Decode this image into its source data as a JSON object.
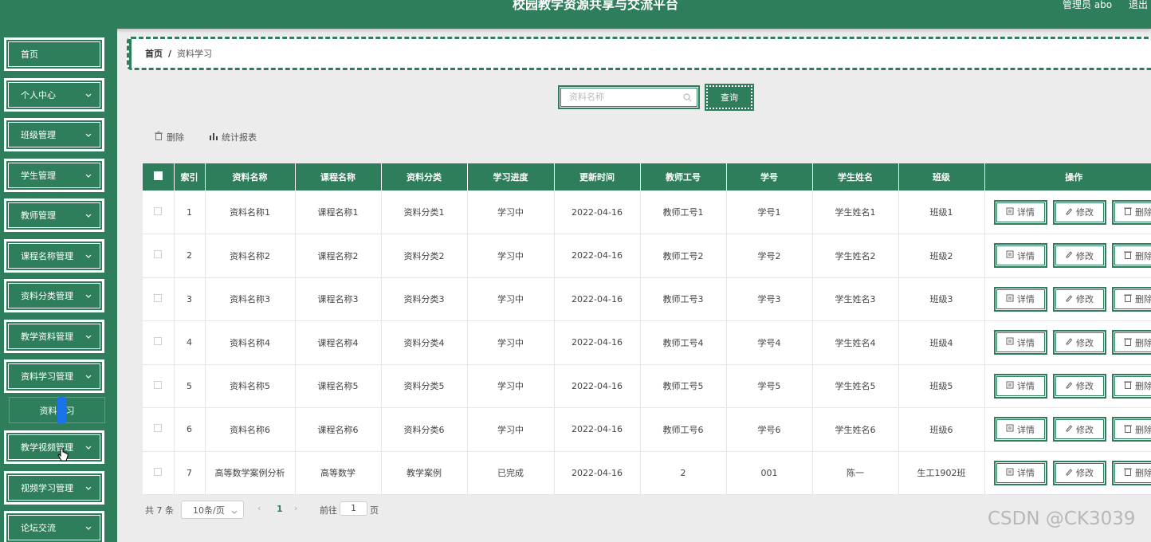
{
  "header": {
    "title": "校园教学资源共享与交流平台",
    "user": "管理员 abo",
    "logout": "退出"
  },
  "sidebar": {
    "items": [
      {
        "label": "首页",
        "expandable": false
      },
      {
        "label": "个人中心",
        "expandable": true
      },
      {
        "label": "班级管理",
        "expandable": true
      },
      {
        "label": "学生管理",
        "expandable": true
      },
      {
        "label": "教师管理",
        "expandable": true
      },
      {
        "label": "课程名称管理",
        "expandable": true
      },
      {
        "label": "资料分类管理",
        "expandable": true
      },
      {
        "label": "教学资料管理",
        "expandable": true
      },
      {
        "label": "资料学习管理",
        "expandable": true
      },
      {
        "label": "教学视频管理",
        "expandable": true
      },
      {
        "label": "视频学习管理",
        "expandable": true
      },
      {
        "label": "论坛交流",
        "expandable": true
      }
    ],
    "sub_item": "资料学习"
  },
  "breadcrumb": {
    "home": "首页",
    "sep": "/",
    "current": "资料学习"
  },
  "search": {
    "placeholder": "资料名称",
    "value": "",
    "button": "查询"
  },
  "toolbar": {
    "delete": "删除",
    "report": "统计报表"
  },
  "table": {
    "columns": [
      "索引",
      "资料名称",
      "课程名称",
      "资料分类",
      "学习进度",
      "更新时间",
      "教师工号",
      "学号",
      "学生姓名",
      "班级",
      "操作"
    ],
    "rows": [
      [
        "1",
        "资料名称1",
        "课程名称1",
        "资料分类1",
        "学习中",
        "2022-04-16",
        "教师工号1",
        "学号1",
        "学生姓名1",
        "班级1"
      ],
      [
        "2",
        "资料名称2",
        "课程名称2",
        "资料分类2",
        "学习中",
        "2022-04-16",
        "教师工号2",
        "学号2",
        "学生姓名2",
        "班级2"
      ],
      [
        "3",
        "资料名称3",
        "课程名称3",
        "资料分类3",
        "学习中",
        "2022-04-16",
        "教师工号3",
        "学号3",
        "学生姓名3",
        "班级3"
      ],
      [
        "4",
        "资料名称4",
        "课程名称4",
        "资料分类4",
        "学习中",
        "2022-04-16",
        "教师工号4",
        "学号4",
        "学生姓名4",
        "班级4"
      ],
      [
        "5",
        "资料名称5",
        "课程名称5",
        "资料分类5",
        "学习中",
        "2022-04-16",
        "教师工号5",
        "学号5",
        "学生姓名5",
        "班级5"
      ],
      [
        "6",
        "资料名称6",
        "课程名称6",
        "资料分类6",
        "学习中",
        "2022-04-16",
        "教师工号6",
        "学号6",
        "学生姓名6",
        "班级6"
      ],
      [
        "7",
        "高等数学案例分析",
        "高等数学",
        "教学案例",
        "已完成",
        "2022-04-16",
        "2",
        "001",
        "陈一",
        "生工1902班"
      ]
    ],
    "actions": [
      "详情",
      "修改",
      "删除"
    ]
  },
  "pagination": {
    "total": "共 7 条",
    "page_size": "10条/页",
    "current": "1",
    "goto_label": "前往",
    "goto_value": "1",
    "page_unit": "页"
  },
  "watermark": "CSDN @CK3039",
  "colors": {
    "primary": "#2e7d5b",
    "background": "#ececec"
  }
}
